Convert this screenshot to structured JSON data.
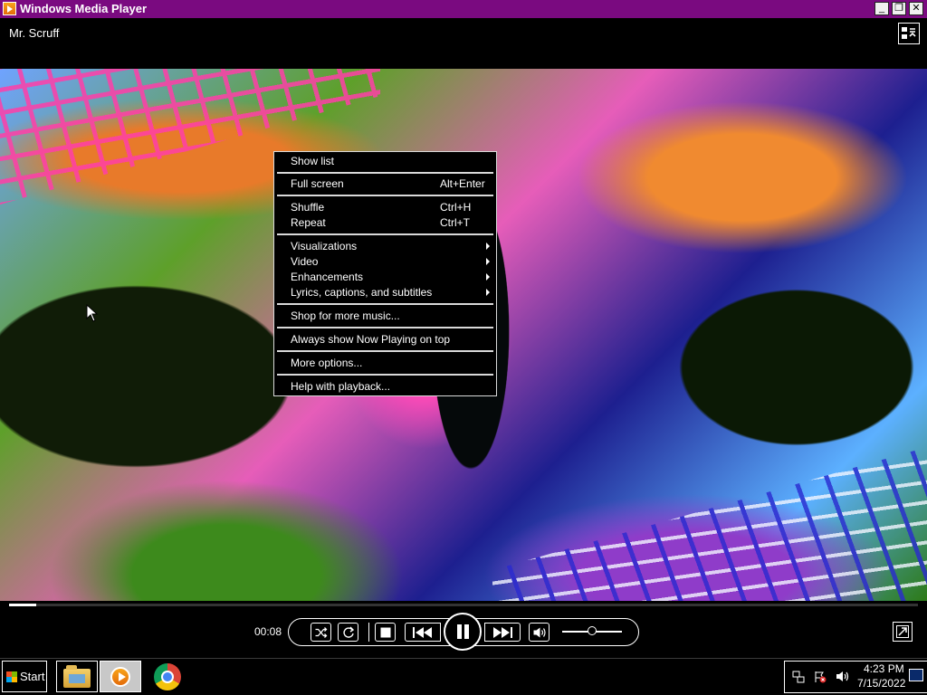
{
  "window": {
    "title": "Windows Media Player",
    "minimize_label": "_",
    "maximize_label": "❐",
    "close_label": "✕"
  },
  "now_playing": {
    "title": "Mr. Scruff"
  },
  "context_menu": {
    "items": [
      {
        "label": "Show list",
        "shortcut": ""
      },
      {
        "label": "Full screen",
        "shortcut": "Alt+Enter"
      },
      {
        "label": "Shuffle",
        "shortcut": "Ctrl+H"
      },
      {
        "label": "Repeat",
        "shortcut": "Ctrl+T"
      },
      {
        "label": "Visualizations",
        "shortcut": "",
        "submenu": true
      },
      {
        "label": "Video",
        "shortcut": "",
        "submenu": true
      },
      {
        "label": "Enhancements",
        "shortcut": "",
        "submenu": true
      },
      {
        "label": "Lyrics, captions, and subtitles",
        "shortcut": "",
        "submenu": true
      },
      {
        "label": "Shop for more music...",
        "shortcut": ""
      },
      {
        "label": "Always show Now Playing on top",
        "shortcut": ""
      },
      {
        "label": "More options...",
        "shortcut": ""
      },
      {
        "label": "Help with playback...",
        "shortcut": ""
      }
    ]
  },
  "playback": {
    "time": "00:08",
    "seek_fraction": 0.03,
    "volume_fraction": 0.5
  },
  "taskbar": {
    "start_label": "Start",
    "clock_time": "4:23 PM",
    "clock_date": "7/15/2022"
  },
  "colors": {
    "title_bar": "#7a0a80",
    "accent": "#ffffff",
    "background": "#000000"
  }
}
